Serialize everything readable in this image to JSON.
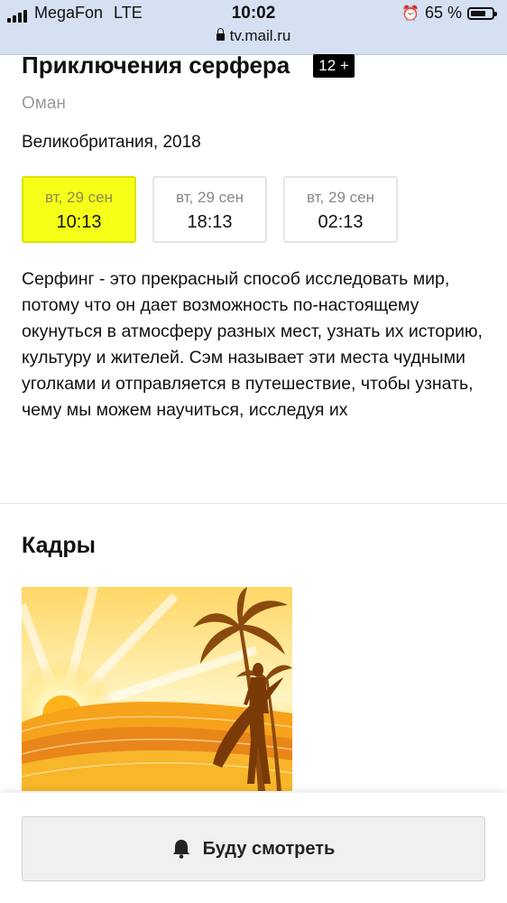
{
  "status": {
    "carrier": "MegaFon",
    "network": "LTE",
    "time": "10:02",
    "battery": "65 %",
    "url": "tv.mail.ru"
  },
  "program": {
    "title": "Приключения серфера",
    "age_rating": "12 +",
    "country_line": "Оман",
    "production": "Великобритания, 2018",
    "sessions": [
      {
        "date": "вт, 29 сен",
        "time": "10:13",
        "active": true
      },
      {
        "date": "вт, 29 сен",
        "time": "18:13",
        "active": false
      },
      {
        "date": "вт, 29 сен",
        "time": "02:13",
        "active": false
      }
    ],
    "description": "Серфинг - это прекрасный способ исследовать мир, потому что он дает возможность по-настоящему окунуться в атмосферу разных мест, узнать их историю, культуру и жителей. Сэм называет эти места чудными уголками и отправляется в путешествие, чтобы узнать, чему мы можем научиться, исследуя их"
  },
  "frames": {
    "title": "Кадры"
  },
  "action": {
    "watch_label": "Буду смотреть",
    "icon": "bell-icon"
  },
  "colors": {
    "active_session": "#f5ff17",
    "status_bar": "#d5e0f2"
  }
}
